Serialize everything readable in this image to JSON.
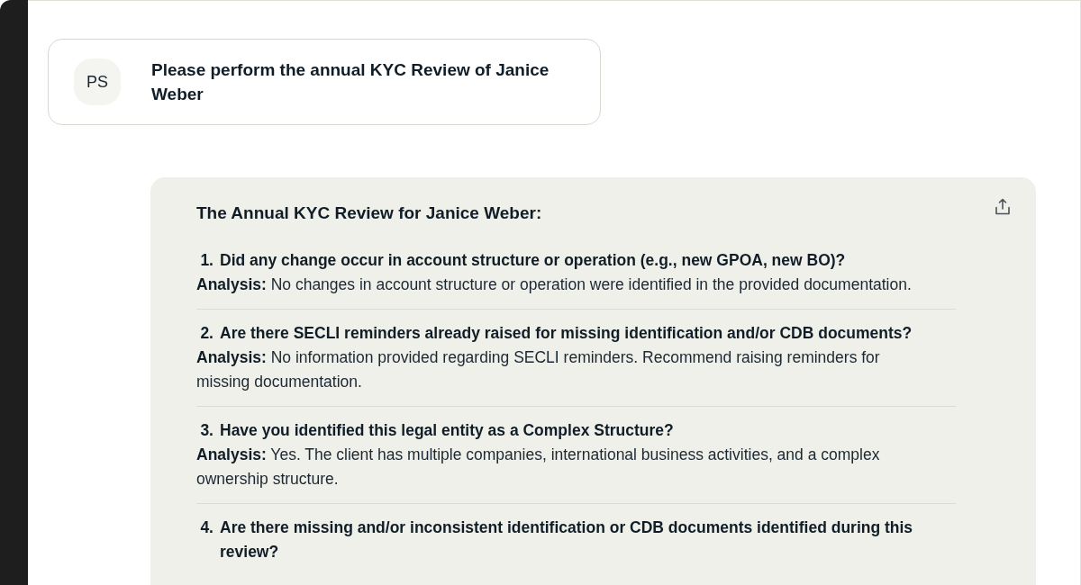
{
  "user_message": {
    "avatar": "PS",
    "text": "Please perform the annual KYC Review of Janice Weber"
  },
  "response": {
    "title": "The Annual KYC Review for Janice Weber:",
    "items": [
      {
        "number": "1.",
        "question": "Did any change occur in account structure or operation (e.g., new GPOA, new BO)?",
        "analysis": "**Analysis:** No changes in account structure or operation were identified in the provided documentation."
      },
      {
        "number": "2.",
        "question": "Are there SECLI reminders already raised for missing identification and/or CDB documents?",
        "analysis": "**Analysis:** No information provided regarding SECLI reminders. Recommend raising reminders for missing documentation."
      },
      {
        "number": "3.",
        "question": "Have you identified this legal entity as a Complex Structure?",
        "analysis": "**Analysis:** Yes. The client has multiple companies, international business activities, and a complex ownership structure."
      },
      {
        "number": "4.",
        "question": "Are there missing and/or inconsistent identification or CDB documents identified during this review?"
      }
    ]
  }
}
